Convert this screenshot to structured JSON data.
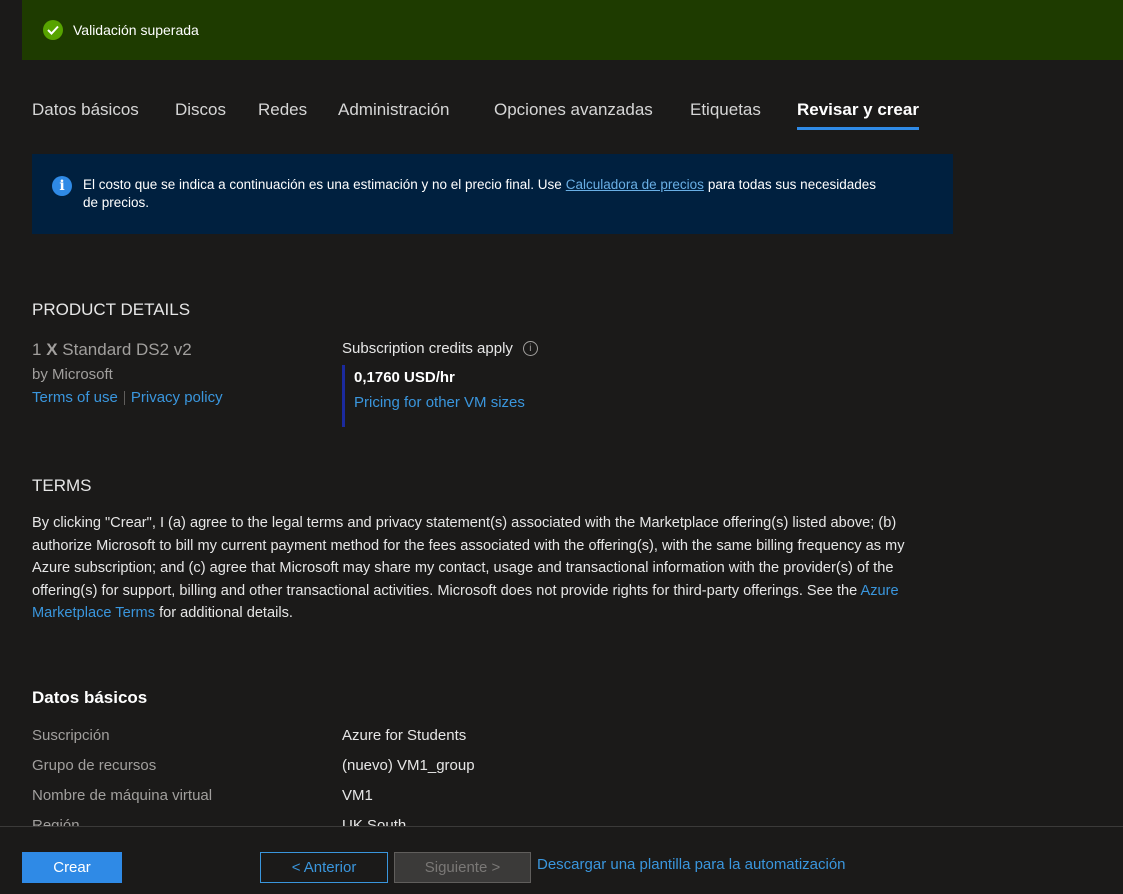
{
  "banner": {
    "text": "Validación superada"
  },
  "tabs": [
    {
      "label": "Datos básicos"
    },
    {
      "label": "Discos"
    },
    {
      "label": "Redes"
    },
    {
      "label": "Administración"
    },
    {
      "label": "Opciones avanzadas"
    },
    {
      "label": "Etiquetas"
    },
    {
      "label": "Revisar y crear",
      "active": true
    }
  ],
  "info": {
    "text_before": "El costo que se indica a continuación es una estimación y no el precio final. Use",
    "link": "Calculadora de precios",
    "text_after": "para todas sus necesidades de precios."
  },
  "product": {
    "heading": "PRODUCT DETAILS",
    "qty": "1",
    "x": "X",
    "name": "Standard DS2 v2",
    "by": "by Microsoft",
    "terms_link": "Terms of use",
    "privacy_link": "Privacy policy",
    "credits": "Subscription credits apply",
    "price": "0,1760 USD/hr",
    "pricing_link": "Pricing for other VM sizes"
  },
  "terms": {
    "heading": "TERMS",
    "text": "By clicking \"Crear\", I (a) agree to the legal terms and privacy statement(s) associated with the Marketplace offering(s) listed above; (b) authorize Microsoft to bill my current payment method for the fees associated with the offering(s), with the same billing frequency as my Azure subscription; and (c) agree that Microsoft may share my contact, usage and transactional information with the provider(s) of the offering(s) for support, billing and other transactional activities. Microsoft does not provide rights for third-party offerings. See the",
    "link": "Azure Marketplace Terms",
    "text_after": "for additional details."
  },
  "basics": {
    "heading": "Datos básicos",
    "rows": [
      {
        "key": "Suscripción",
        "value": "Azure for Students"
      },
      {
        "key": "Grupo de recursos",
        "value": "(nuevo) VM1_group"
      },
      {
        "key": "Nombre de máquina virtual",
        "value": "VM1"
      },
      {
        "key": "Región",
        "value": "UK South"
      }
    ]
  },
  "footer": {
    "create": "Crear",
    "prev": "< Anterior",
    "next": "Siguiente >",
    "download": "Descargar una plantilla para la automatización"
  }
}
